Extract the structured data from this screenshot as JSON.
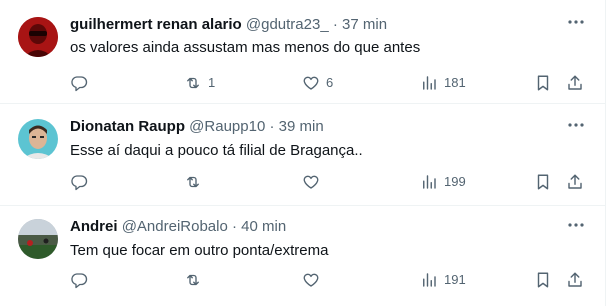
{
  "tweets": [
    {
      "name": "guilhermert renan alario",
      "handle": "@gdutra23_",
      "separator": "·",
      "time": "37 min",
      "text": "os valores ainda assustam mas menos do que antes",
      "replies": "",
      "retweets": "1",
      "likes": "6",
      "views": "181",
      "avatar_colors": [
        "#7a0c0c",
        "#b51515"
      ]
    },
    {
      "name": "Dionatan Raupp",
      "handle": "@Raupp10",
      "separator": "·",
      "time": "39 min",
      "text": "Esse aí daqui a pouco tá filial de Bragança..",
      "replies": "",
      "retweets": "",
      "likes": "",
      "views": "199",
      "avatar_colors": [
        "#58c2cf",
        "#d9b497"
      ]
    },
    {
      "name": "Andrei",
      "handle": "@AndreiRobalo",
      "separator": "·",
      "time": "40 min",
      "text": "Tem que focar em outro ponta/extrema",
      "replies": "",
      "retweets": "",
      "likes": "",
      "views": "191",
      "avatar_colors": [
        "#2f4a2a",
        "#8e9aa5"
      ]
    }
  ],
  "icons": {
    "more": "more-icon",
    "reply": "reply-icon",
    "retweet": "retweet-icon",
    "like": "heart-icon",
    "views": "views-icon",
    "bookmark": "bookmark-icon",
    "share": "share-icon"
  },
  "colors": {
    "text": "#0f1419",
    "secondary": "#536471",
    "border": "#eff3f4"
  }
}
